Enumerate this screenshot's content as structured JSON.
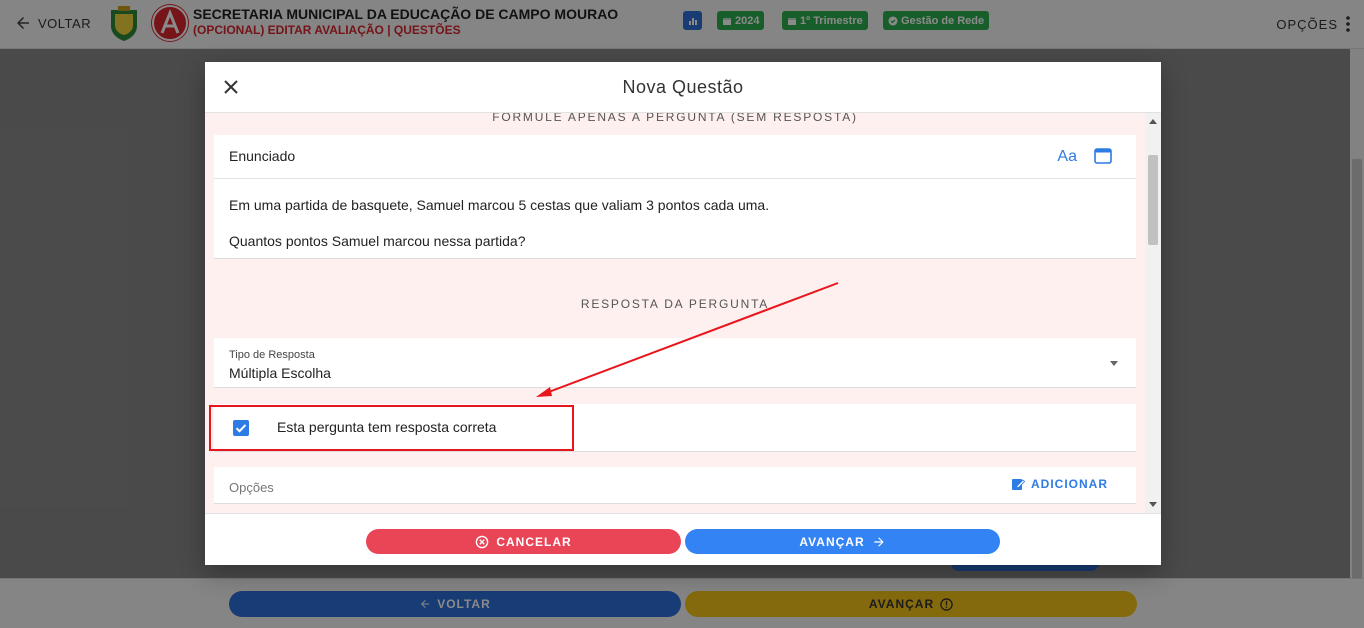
{
  "topbar": {
    "back_label": "VOLTAR",
    "org_title": "SECRETARIA MUNICIPAL DA EDUCAÇÃO DE CAMPO MOURAO",
    "page_subtitle": "(OPCIONAL) EDITAR AVALIAÇÃO | QUESTÕES",
    "chips": [
      {
        "icon": "bar-chart-icon",
        "label": ""
      },
      {
        "icon": "calendar-icon",
        "label": "2024"
      },
      {
        "icon": "calendar-icon",
        "label": "1º Trimestre"
      },
      {
        "icon": "check-circle-icon",
        "label": "Gestão de Rede"
      }
    ],
    "options_label": "OPÇÕES"
  },
  "background": {
    "back_button": "VOLTAR",
    "next_button": "AVANÇAR"
  },
  "modal": {
    "title": "Nova Questão",
    "section_question": "FORMULE APENAS A PERGUNTA (SEM RESPOSTA)",
    "enunciado_label": "Enunciado",
    "format_icon_text": "Aa",
    "enunciado_lines": [
      "Em uma partida de basquete, Samuel marcou 5 cestas que valiam 3 pontos cada uma.",
      "Quantos pontos Samuel marcou nessa partida?"
    ],
    "section_answer": "RESPOSTA DA PERGUNTA",
    "tipo_label": "Tipo de Resposta",
    "tipo_value": "Múltipla Escolha",
    "correct_checkbox_label": "Esta pergunta tem resposta correta",
    "correct_checked": true,
    "opcoes_label": "Opções",
    "add_label": "ADICIONAR",
    "cancel_label": "CANCELAR",
    "next_label": "AVANÇAR"
  },
  "colors": {
    "accent_blue": "#3383f4",
    "cancel_red": "#ea4457",
    "chip_green": "#2eae4e",
    "annotation_red": "#e8161c",
    "brand_red": "#d9252f"
  }
}
